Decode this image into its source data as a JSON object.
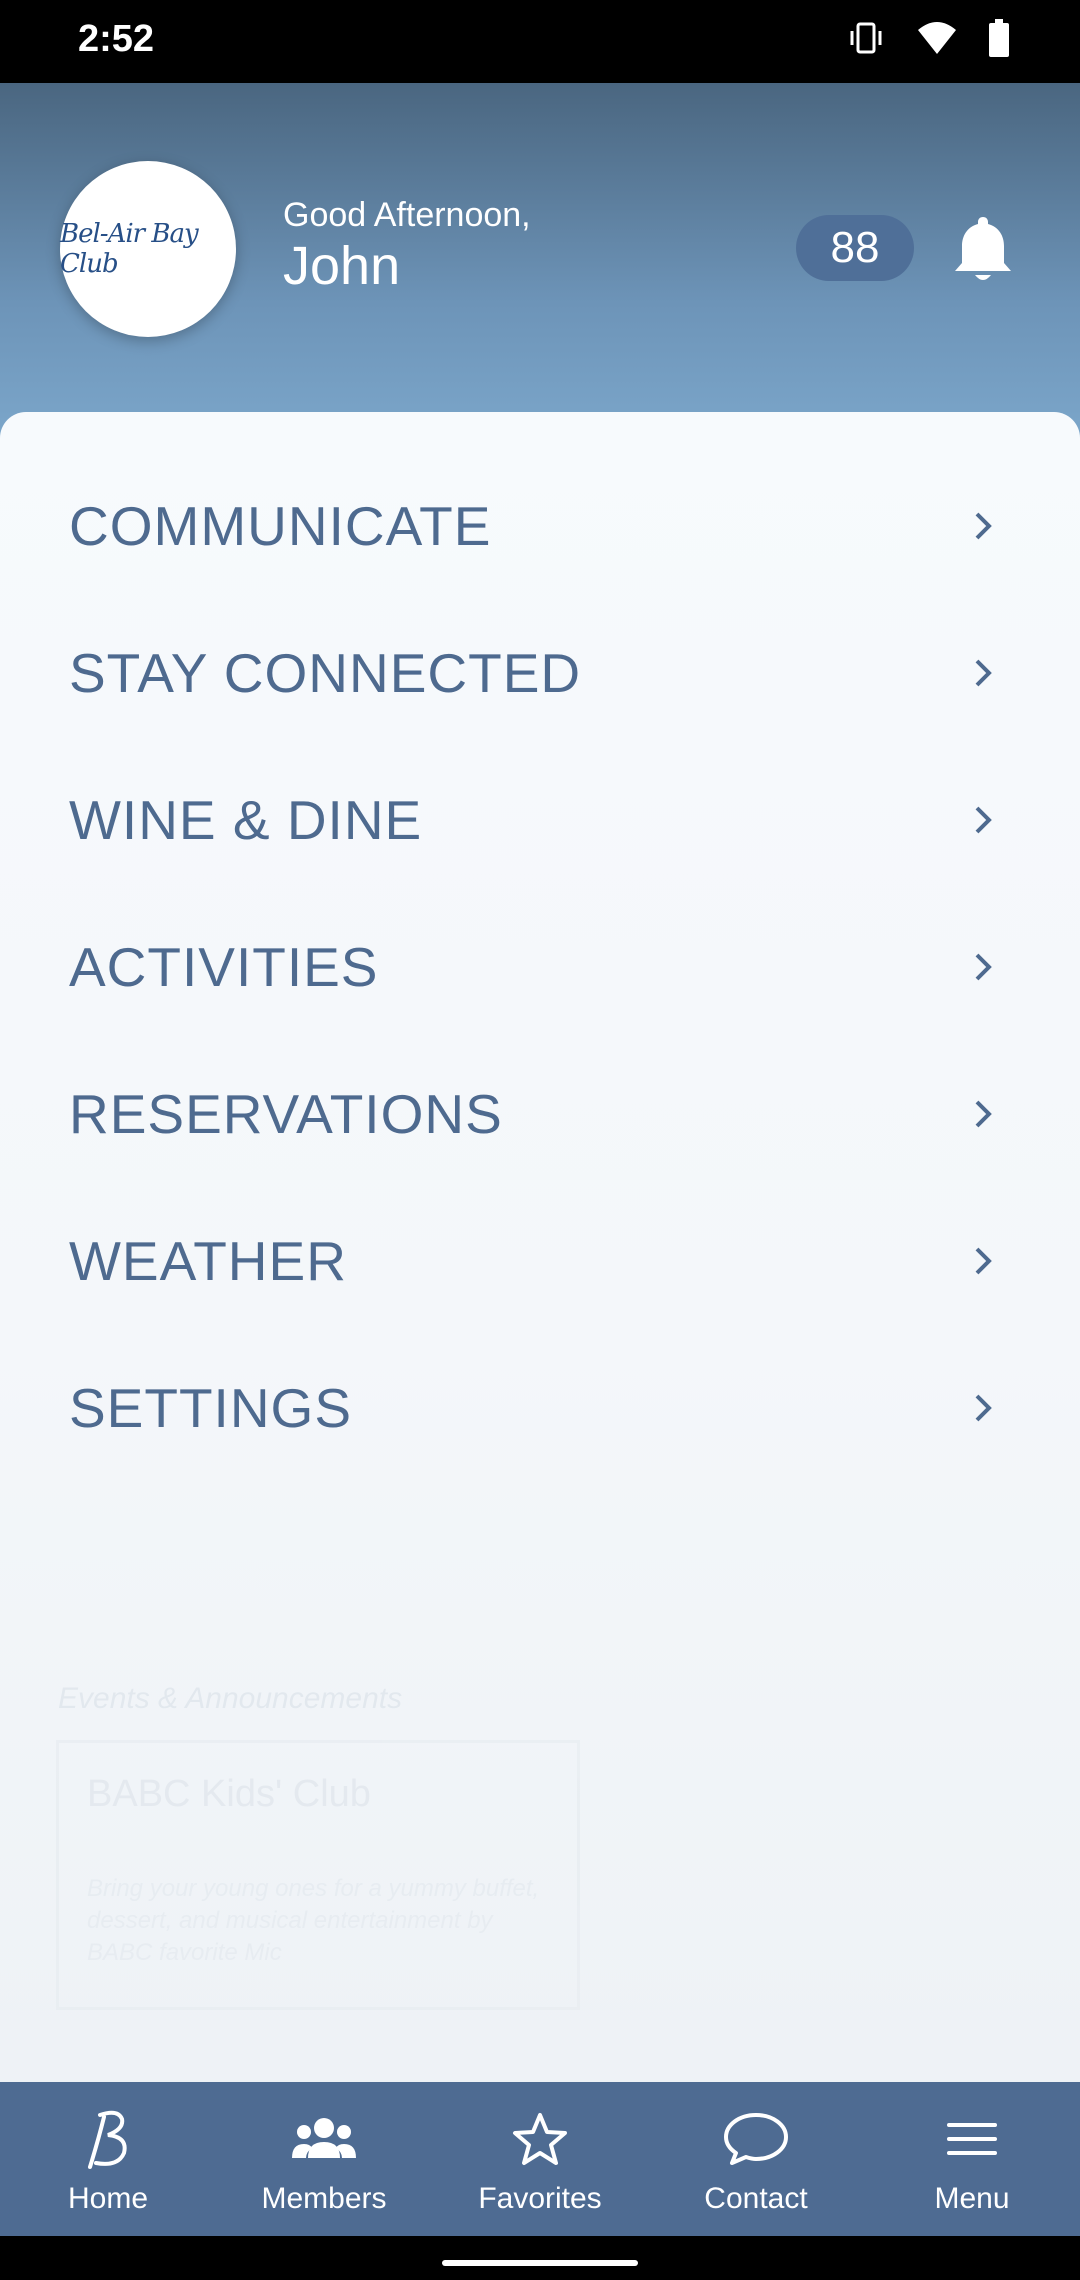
{
  "status_bar": {
    "time": "2:52",
    "icons": [
      "vibrate-icon",
      "wifi-icon",
      "battery-icon"
    ]
  },
  "header": {
    "logo_text": "Bel-Air Bay Club",
    "greeting": "Good Afternoon,",
    "user_name": "John",
    "notification_count": "88"
  },
  "menu": {
    "items": [
      {
        "label": "COMMUNICATE"
      },
      {
        "label": "STAY CONNECTED"
      },
      {
        "label": "WINE & DINE"
      },
      {
        "label": "ACTIVITIES"
      },
      {
        "label": "RESERVATIONS"
      },
      {
        "label": "WEATHER"
      },
      {
        "label": "SETTINGS"
      }
    ]
  },
  "background_events": {
    "section_title": "Events & Announcements",
    "card_title": "BABC Kids' Club",
    "card_body": "Bring your young ones for a yummy buffet, dessert, and musical entertainment by BABC favorite Mic"
  },
  "bottom_nav": {
    "items": [
      {
        "label": "Home",
        "icon": "b-logo-icon"
      },
      {
        "label": "Members",
        "icon": "members-icon"
      },
      {
        "label": "Favorites",
        "icon": "star-icon"
      },
      {
        "label": "Contact",
        "icon": "chat-bubble-icon"
      },
      {
        "label": "Menu",
        "icon": "hamburger-menu-icon"
      }
    ]
  },
  "colors": {
    "accent": "#4e6b92",
    "menu_text": "#4e6a8f",
    "badge": "#4f6f98"
  }
}
